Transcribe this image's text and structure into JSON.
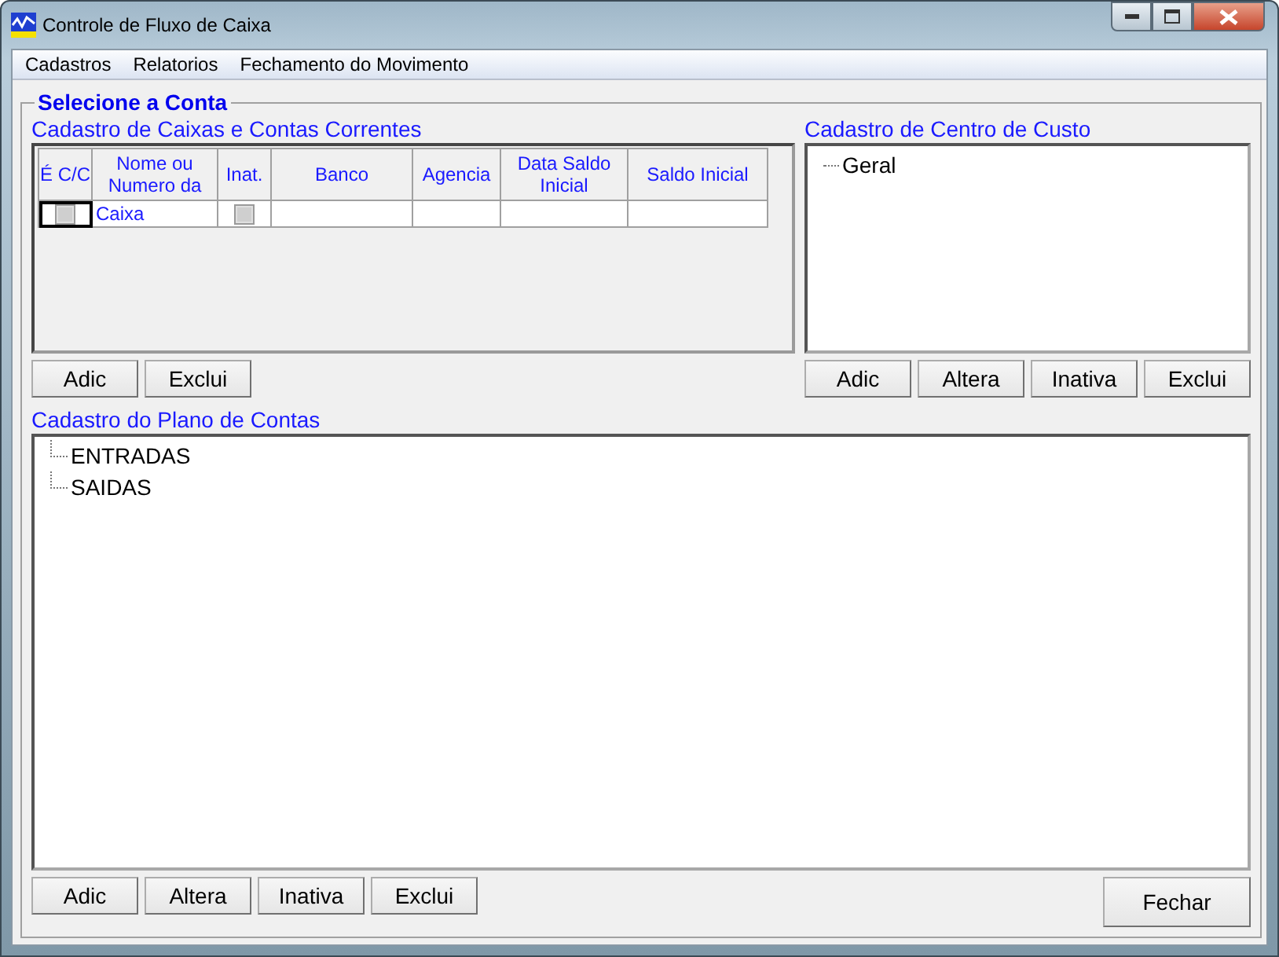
{
  "window": {
    "title": "Controle de Fluxo de Caixa"
  },
  "menu": [
    "Cadastros",
    "Relatorios",
    "Fechamento do Movimento"
  ],
  "group": {
    "title": "Selecione a Conta"
  },
  "accounts": {
    "title": "Cadastro de Caixas e Contas Correntes",
    "columns": [
      "É C/C",
      "Nome ou Numero da",
      "Inat.",
      "Banco",
      "Agencia",
      "Data Saldo Inicial",
      "Saldo Inicial"
    ],
    "rows": [
      {
        "is_checking": false,
        "name": "Caixa",
        "inactive": false,
        "bank": "",
        "agency": "",
        "date": "",
        "balance": ""
      }
    ],
    "buttons": [
      "Adic",
      "Exclui"
    ]
  },
  "cost_centers": {
    "title": "Cadastro de Centro de Custo",
    "items": [
      {
        "label": "Geral"
      }
    ],
    "buttons": [
      "Adic",
      "Altera",
      "Inativa",
      "Exclui"
    ]
  },
  "chart_of_accounts": {
    "title": "Cadastro do Plano de Contas",
    "items": [
      {
        "label": "ENTRADAS"
      },
      {
        "label": "SAIDAS"
      }
    ],
    "buttons": [
      "Adic",
      "Altera",
      "Inativa",
      "Exclui"
    ]
  },
  "close_button": "Fechar"
}
